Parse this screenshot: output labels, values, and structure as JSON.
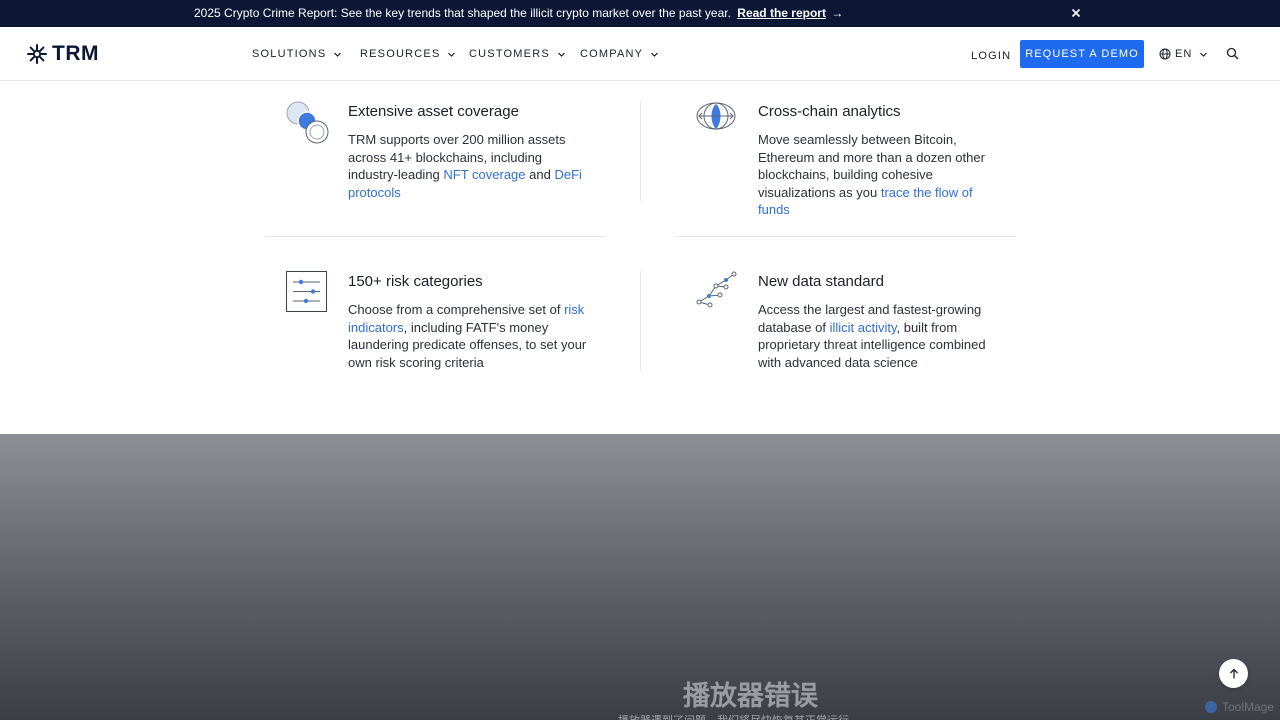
{
  "announcement": {
    "message": "2025 Crypto Crime Report: See the key trends that shaped the illicit crypto market over the past year.",
    "link": "Read the report",
    "arrow": "→"
  },
  "header": {
    "logo": "TRM",
    "nav": [
      {
        "label": "SOLUTIONS"
      },
      {
        "label": "RESOURCES"
      },
      {
        "label": "CUSTOMERS"
      },
      {
        "label": "COMPANY"
      }
    ],
    "login": "LOGIN",
    "cta": "REQUEST A DEMO",
    "language": "EN"
  },
  "features": [
    {
      "title": "Extensive asset coverage",
      "icon": "asset-coverage-icon",
      "text_1": "TRM supports over 200 million assets across 41+ blockchains, including industry-leading ",
      "link_1": "NFT coverage",
      "text_2": " and ",
      "link_2": "DeFi protocols"
    },
    {
      "title": "Cross-chain analytics",
      "icon": "cross-chain-icon",
      "text_1": "Move seamlessly between Bitcoin, Ethereum and more than a dozen other blockchains, building cohesive visualizations as you ",
      "link_1": "trace the flow of funds"
    },
    {
      "title": "150+ risk categories",
      "icon": "risk-sliders-icon",
      "text_1": "Choose from a comprehensive set of ",
      "link_1": "risk indicators",
      "text_2": ", including FATF's money laundering predicate offenses, to set your own risk scoring criteria"
    },
    {
      "title": "New data standard",
      "icon": "data-graph-icon",
      "text_1": "Access the largest and fastest-growing database of ",
      "link_1": "illicit activity",
      "text_2": ", built from proprietary threat intelligence combined with advanced data science"
    }
  ],
  "video": {
    "error_title": "播放器错误",
    "error_subtitle": "播放器遇到了问题，我们将尽快恢复其正常运行"
  },
  "watermark": "ToolMage",
  "colors": {
    "accent": "#1f6bf0",
    "link": "#2f6fd6",
    "announce_bg": "#0b1735"
  }
}
